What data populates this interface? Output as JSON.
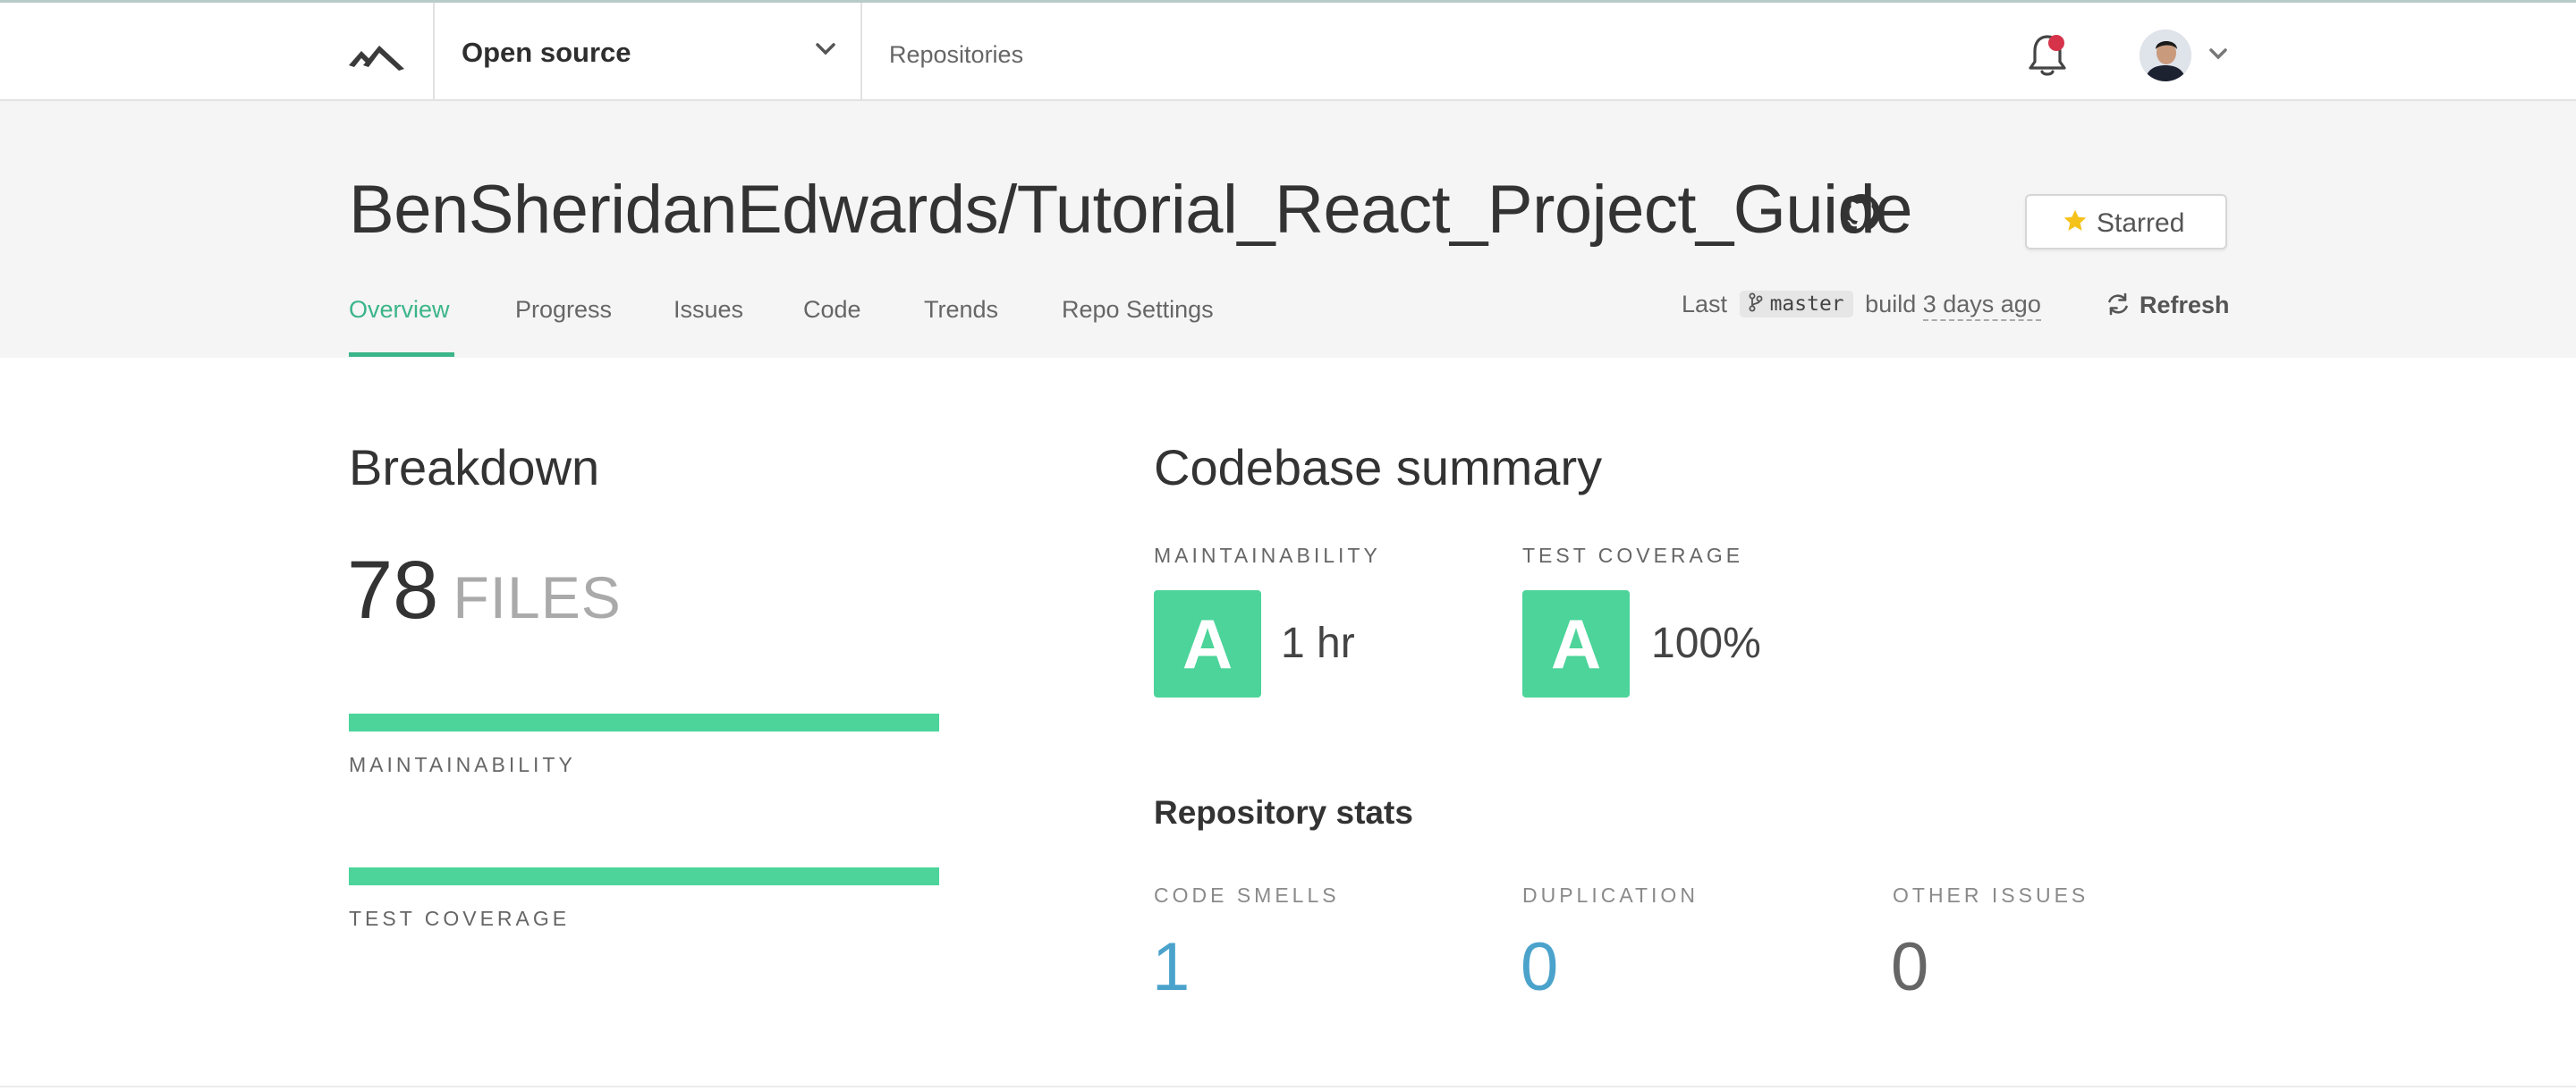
{
  "topbar": {
    "org_label": "Open source",
    "repositories_label": "Repositories",
    "icons": {
      "logo": "codeclimate-logo-icon",
      "org_chevron": "chevron-down-icon",
      "bell": "bell-icon",
      "avatar_chevron": "chevron-down-icon"
    },
    "notification_dot_color": "#d6334a"
  },
  "repo": {
    "title": "BenSheridanEdwards/Tutorial_React_Project_Guide",
    "star_label": "Starred",
    "tabs": [
      {
        "label": "Overview",
        "active": true
      },
      {
        "label": "Progress",
        "active": false
      },
      {
        "label": "Issues",
        "active": false
      },
      {
        "label": "Code",
        "active": false
      },
      {
        "label": "Trends",
        "active": false
      },
      {
        "label": "Repo Settings",
        "active": false
      }
    ],
    "last_build": {
      "prefix": "Last",
      "branch": "master",
      "middle": "build",
      "when": "3 days ago"
    },
    "refresh_label": "Refresh"
  },
  "breakdown": {
    "heading": "Breakdown",
    "files_count": "78",
    "files_unit": "FILES",
    "bars": [
      {
        "label": "MAINTAINABILITY",
        "fill": 1.0
      },
      {
        "label": "TEST COVERAGE",
        "fill": 1.0
      }
    ]
  },
  "summary": {
    "heading": "Codebase summary",
    "maintainability": {
      "label": "MAINTAINABILITY",
      "grade": "A",
      "value": "1 hr"
    },
    "test_coverage": {
      "label": "TEST COVERAGE",
      "grade": "A",
      "value": "100%"
    },
    "stats_heading": "Repository stats",
    "stats": [
      {
        "label": "CODE SMELLS",
        "value": "1"
      },
      {
        "label": "DUPLICATION",
        "value": "0"
      },
      {
        "label": "OTHER ISSUES",
        "value": "0"
      }
    ]
  },
  "colors": {
    "accent_green": "#3bb58a",
    "grade_green": "#4cd49a",
    "link_blue": "#4ba3cc",
    "header_bg": "#f5f5f5"
  }
}
